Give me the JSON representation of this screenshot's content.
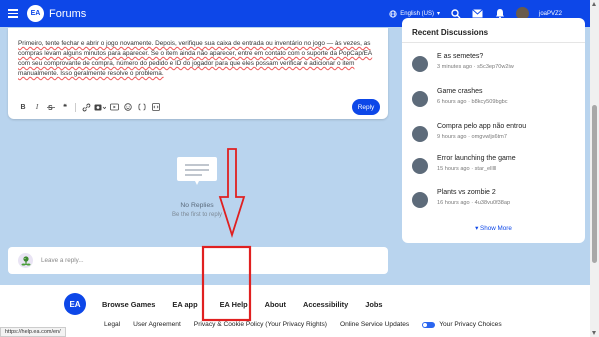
{
  "header": {
    "brand": "Forums",
    "logo_text": "EA",
    "language": "English (US)",
    "username": "joaPVZ2",
    "colors": {
      "primary": "#0d47e8"
    }
  },
  "editor": {
    "text": "Primeiro, tente fechar e abrir o jogo novamente. Depois, verifique sua caixa de entrada ou inventário no jogo — às vezes, as compras levam alguns minutos para aparecer. Se o item ainda não aparecer, entre em contato com o suporte da PopCap/EA com seu comprovante de compra, número do pedido e ID do jogador para que eles possam verificar e adicionar o item manualmente. Isso geralmente resolve o problema.",
    "toolbar": {
      "bold": "B",
      "italic": "I",
      "quote": "❝"
    },
    "reply_label": "Reply"
  },
  "no_replies": {
    "title": "No Replies",
    "subtitle": "Be the first to reply"
  },
  "leave_reply": {
    "placeholder": "Leave a reply..."
  },
  "sidebar": {
    "title": "Recent Discussions",
    "items": [
      {
        "title": "E as semetes?",
        "meta": "3 minutes ago · s5c3ep70w2iw"
      },
      {
        "title": "Game crashes",
        "meta": "6 hours ago · b8kcy509bgbc"
      },
      {
        "title": "Compra pelo app não entrou",
        "meta": "9 hours ago · omgvwljs6tm7"
      },
      {
        "title": "Error launching the game",
        "meta": "15 hours ago · star_elllll"
      },
      {
        "title": "Plants vs zombie 2",
        "meta": "16 hours ago · 4u38vu0f38ap"
      }
    ],
    "show_more": "Show More"
  },
  "footer": {
    "logo_text": "EA",
    "links": [
      "Browse Games",
      "EA app",
      "EA Help",
      "About",
      "Accessibility",
      "Jobs"
    ],
    "bottom_links": [
      "Legal",
      "User Agreement",
      "Privacy & Cookie Policy (Your Privacy Rights)",
      "Online Service Updates",
      "Your Privacy Choices"
    ]
  },
  "status_bar_url": "https://help.ea.com/en/"
}
